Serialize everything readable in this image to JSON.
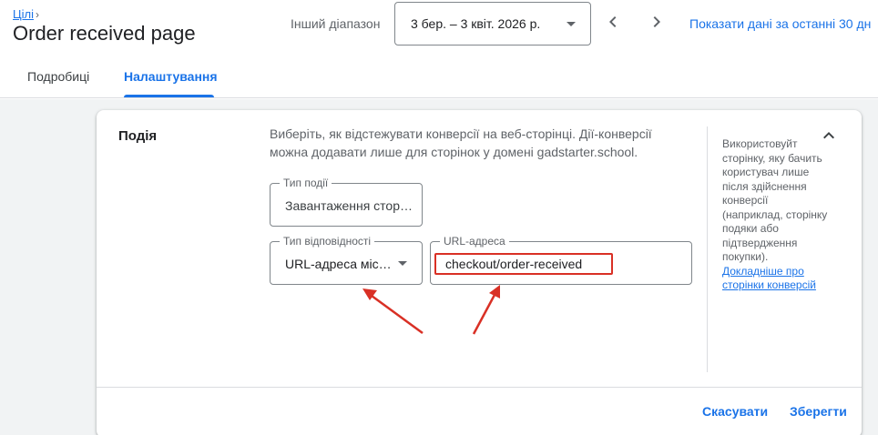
{
  "header": {
    "breadcrumb_label": "Цілі",
    "page_title": "Order received page",
    "range_label": "Інший діапазон",
    "range_value": "3 бер. – 3 квіт. 2026 р.",
    "show_last_label": "Показати дані за останні 30 дн"
  },
  "tabs": [
    {
      "label": "Подробиці",
      "active": false
    },
    {
      "label": "Налаштування",
      "active": true
    }
  ],
  "card": {
    "section_label": "Подія",
    "description": "Виберіть, як відстежувати конверсії на веб-сторінці. Дії-конверсії можна додавати лише для сторінок у домені gadstarter.school.",
    "event_type": {
      "label": "Тип події",
      "value": "Завантаження стор…"
    },
    "match_type": {
      "label": "Тип відповідності",
      "value": "URL-адреса міс…"
    },
    "url": {
      "label": "URL-адреса",
      "value": "checkout/order-received"
    },
    "help_text": "Використовуйт сторінку, яку бачить користувач лише після здійснення конверсії (наприклад, сторінку подяки або підтвердження покупки).",
    "help_link": "Докладніше про сторінки конверсій",
    "cancel_label": "Скасувати",
    "save_label": "Зберегти"
  },
  "colors": {
    "accent": "#1a73e8",
    "annotation_red": "#d93025"
  },
  "icons": {
    "breadcrumb_separator": "chevron-right-icon",
    "range_dropdown": "caret-down-icon",
    "prev": "chevron-left-icon",
    "next": "chevron-right-icon",
    "collapse": "chevron-up-icon",
    "match_dropdown": "caret-down-icon"
  }
}
